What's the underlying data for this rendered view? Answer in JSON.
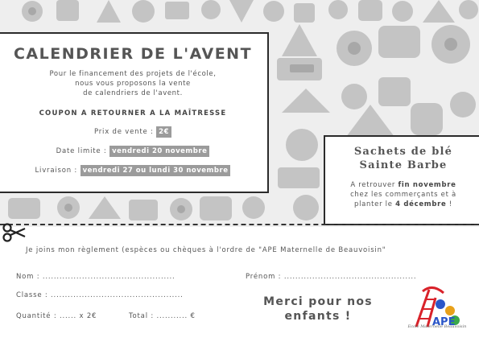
{
  "main": {
    "title": "CALENDRIER DE L'AVENT",
    "intro": [
      "Pour le financement des projets de l'école,",
      "nous vous proposons la vente",
      "de calendriers de l'avent."
    ],
    "coupon_heading": "COUPON A RETOURNER A LA MAÎTRESSE",
    "price_label": "Prix de vente :",
    "price_value": "2€",
    "deadline_label": "Date limite :",
    "deadline_value": "vendredi 20 novembre",
    "delivery_label": "Livraison :",
    "delivery_value": "vendredi 27 ou lundi 30 novembre"
  },
  "side": {
    "title_line1": "Sachets de blé",
    "title_line2": "Sainte Barbe",
    "text_1": "A retrouver ",
    "text_bold_1": "fin novembre",
    "text_2": "chez les commerçants et à",
    "text_3": "planter le ",
    "text_bold_2": "4 décembre",
    "text_4": " !"
  },
  "form": {
    "intro": "Je joins mon règlement (espèces ou chèques à l'ordre de \"APE Maternelle de Beauvoisin\"",
    "nom": "Nom : ...............................................",
    "prenom": "Prénom : ...............................................",
    "classe": "Classe : ...............................................",
    "quantite": "Quantité : ...... x 2€",
    "total": "Total : ........... €"
  },
  "footer": {
    "merci_line1": "Merci pour nos",
    "merci_line2": "enfants !",
    "logo_text": "APE",
    "logo_caption": "Ecole Maternelle Beauvoisin"
  },
  "colors": {
    "highlight": "#9b9b9b",
    "border": "#2b2b2b",
    "pattern_bg": "#eeeeee",
    "pattern_shape": "#c2c2c2"
  }
}
